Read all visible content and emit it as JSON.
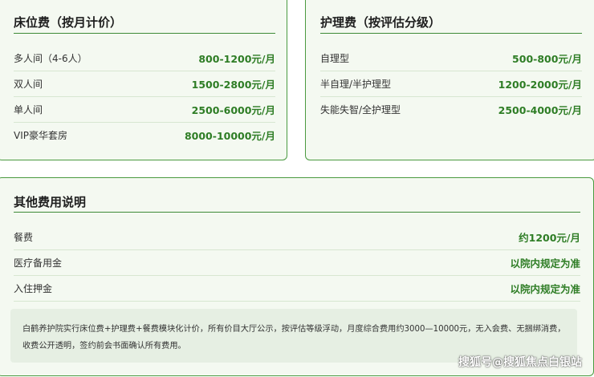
{
  "bed_card": {
    "title": "床位费（按月计价）",
    "rows": [
      {
        "label": "多人间（4-6人）",
        "price": "800-1200元/月"
      },
      {
        "label": "双人间",
        "price": "1500-2800元/月"
      },
      {
        "label": "单人间",
        "price": "2500-6000元/月"
      },
      {
        "label": "VIP豪华套房",
        "price": "8000-10000元/月"
      }
    ]
  },
  "care_card": {
    "title": "护理费（按评估分级）",
    "rows": [
      {
        "label": "自理型",
        "price": "500-800元/月"
      },
      {
        "label": "半自理/半护理型",
        "price": "1200-2000元/月"
      },
      {
        "label": "失能失智/全护理型",
        "price": "2500-4000元/月"
      }
    ]
  },
  "other_card": {
    "title": "其他费用说明",
    "rows": [
      {
        "label": "餐费",
        "price": "约1200元/月"
      },
      {
        "label": "医疗备用金",
        "price": "以院内规定为准"
      },
      {
        "label": "入住押金",
        "price": "以院内规定为准"
      }
    ],
    "note": "白鹤养护院实行床位费+护理费+餐费模块化计价，所有价目大厅公示，按评估等级浮动，月度综合费用约3000—10000元，无入会费、无捆绑消费，收费公开透明，签约前会书面确认所有费用。"
  },
  "watermark": "搜狐号@搜狐焦点白银站",
  "colors": {
    "accent": "#2e7d25",
    "border": "#4a9a40",
    "card_bg": "#f4f9f1",
    "note_bg": "#e6efe3"
  }
}
